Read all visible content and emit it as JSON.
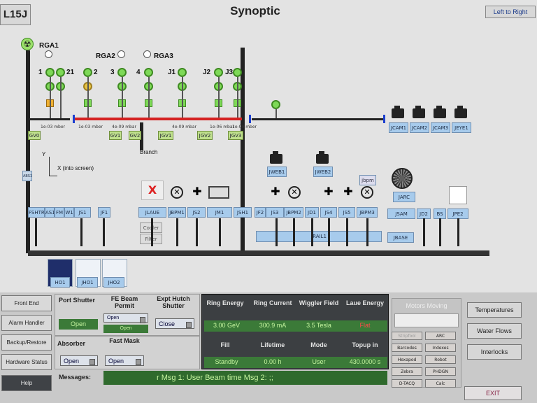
{
  "header": {
    "station": "L15J",
    "title": "Synoptic",
    "direction": "Left to Right"
  },
  "rga": {
    "rga1": "RGA1",
    "rga2": "RGA2",
    "rga3": "RGA3"
  },
  "gauge_labels": [
    "1",
    "21",
    "2",
    "3",
    "4",
    "J1",
    "J2",
    "J3"
  ],
  "pressures": [
    "1e-03 mber",
    "1e-03 mber",
    "4e-09 mbar",
    "4e-09 mbar",
    "1e-06 mbar",
    "1e-09 mber"
  ],
  "gate_valves": [
    "GV0",
    "GV1",
    "GV2",
    "JGV1",
    "JGV2",
    "JGV3"
  ],
  "branch": "Branch",
  "axes": {
    "y": "Y",
    "x": "X (into screen)"
  },
  "left_devices": [
    "ABS1",
    "FSHTR",
    "AS1",
    "FM",
    "W1",
    "JS1",
    "JF1"
  ],
  "mid_devices": [
    "JLAUE",
    "JBPM1",
    "JS2",
    "JM1",
    "JSH1"
  ],
  "right_devices": [
    "JF2",
    "JS3",
    "JBPM2",
    "JD1",
    "JS4",
    "JS5",
    "JBPM3",
    "JSAM",
    "JD2",
    "BS",
    "JPE2"
  ],
  "cameras": [
    "JCAM1",
    "JCAM2",
    "JCAM3",
    "JEYE1"
  ],
  "web_cams": [
    "JWEB1",
    "JWEB2"
  ],
  "misc": {
    "jbpm": "jbpm",
    "jarc": "JARC",
    "jrail": "JRAIL1",
    "jbase": "JBASE",
    "cooler": "Cooler",
    "filter": "Filter",
    "x_mark": "X"
  },
  "hutch": [
    "HO1",
    "JHO1",
    "JHO2"
  ],
  "nav": [
    "Front End",
    "Alarm Handler",
    "Backup/Restore",
    "Hardware Status",
    "Help"
  ],
  "status": {
    "port_shutter_label": "Port Shutter",
    "port_shutter": "Open",
    "fe_beam_label": "FE Beam Permit",
    "fe_beam_dd": "Open",
    "fe_beam": "Open",
    "expt_hutch_label": "Expt Hutch Shutter",
    "expt_hutch": "Close",
    "absorber_label": "Absorber",
    "absorber": "Open",
    "fast_mask_label": "Fast Mask",
    "fast_mask": "Open"
  },
  "ring": {
    "energy_label": "Ring Energy",
    "energy": "3.00 GeV",
    "current_label": "Ring Current",
    "current": "300.9 mA",
    "wiggler_label": "Wiggler Field",
    "wiggler": "3.5 Tesla",
    "laue_label": "Laue Energy",
    "laue": "Flat",
    "fill_label": "Fill",
    "fill": "Standby",
    "lifetime_label": "Lifetime",
    "lifetime": "0.00 h",
    "mode_label": "Mode",
    "mode": "User",
    "topup_label": "Topup in",
    "topup": "430.0000 s"
  },
  "messages": {
    "label": "Messages:",
    "text": "r   Msg 1: User Beam time   Msg 2: ;;"
  },
  "motors": {
    "title": "Motors Moving",
    "buttons": [
      "Stripfool",
      "ARC",
      "Barcodes",
      "Indexes",
      "Hexapod",
      "Robot",
      "Zebra",
      "PHDGN",
      "D-TACQ",
      "Calc"
    ]
  },
  "right_nav": [
    "Temperatures",
    "Water Flows",
    "Interlocks",
    "EXIT"
  ],
  "colors": {
    "beamline_red": "#d42222",
    "gauge_green": "#7ed957",
    "device_blue": "#a7cbec",
    "status_green": "#3b7a38"
  }
}
